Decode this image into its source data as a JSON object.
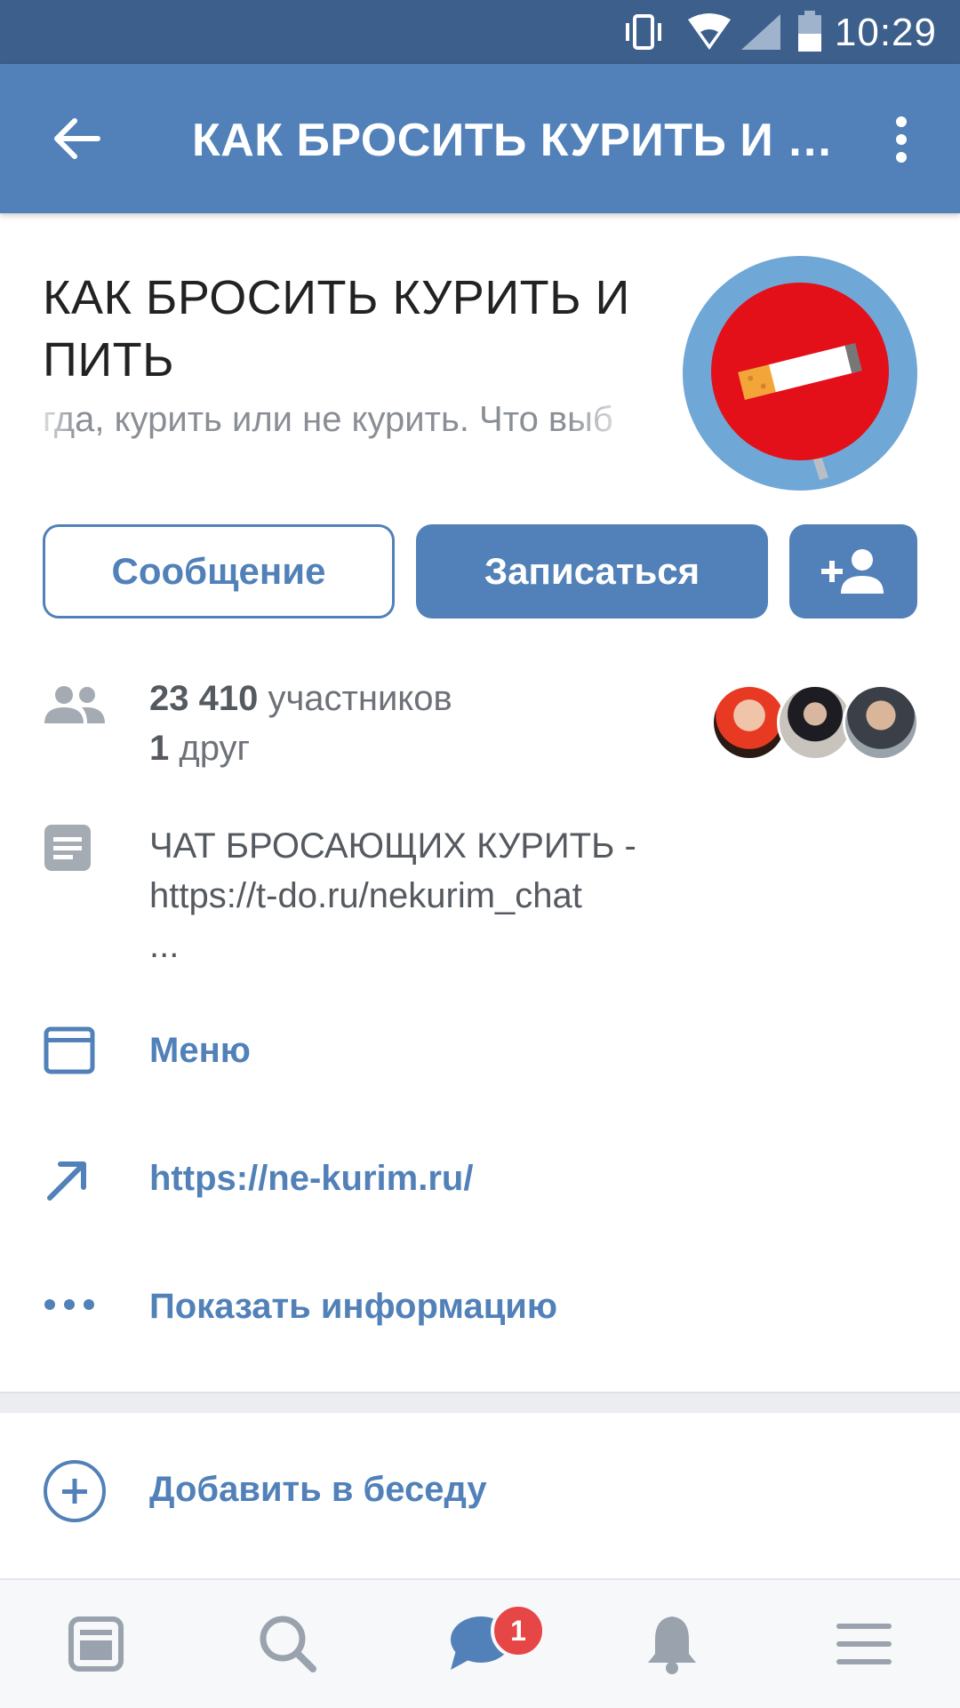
{
  "status_bar": {
    "time": "10:29"
  },
  "toolbar": {
    "title": "КАК БРОСИТЬ КУРИТЬ И П..."
  },
  "group": {
    "name": "КАК БРОСИТЬ КУРИТЬ И ПИТЬ",
    "status": "гда, курить или не курить. Что выб"
  },
  "actions": {
    "message_label": "Сообщение",
    "subscribe_label": "Записаться"
  },
  "members": {
    "count": "23 410",
    "count_suffix": " участников",
    "friends_count": "1",
    "friends_suffix": " друг"
  },
  "description": {
    "line1": "ЧАТ БРОСАЮЩИХ КУРИТЬ -",
    "line2": "https://t-do.ru/nekurim_chat",
    "line3": "..."
  },
  "links": {
    "menu": "Меню",
    "site": "https://ne-kurim.ru/",
    "show_info": "Показать информацию",
    "add_to_chat": "Добавить в беседу"
  },
  "bottom_nav": {
    "items": [
      "news-icon",
      "search-icon",
      "messages-icon",
      "notifications-icon",
      "menu-icon"
    ],
    "messages_badge": "1"
  },
  "colors": {
    "brand": "#5181b8",
    "status_bar": "#3d5f8c",
    "badge": "#e64646"
  }
}
